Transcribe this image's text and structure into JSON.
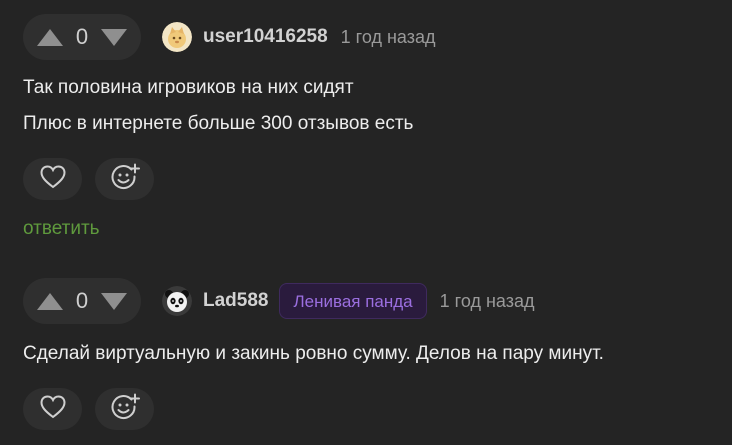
{
  "comments": [
    {
      "vote_count": "0",
      "username": "user10416258",
      "badge": "",
      "time": "1 год назад",
      "lines": [
        "Так половина игровиков на них сидят",
        "Плюс в интернете больше 300 отзывов есть"
      ],
      "reply_label": "ответить",
      "avatar_icon": "cat-avatar",
      "actions": [
        "heart-icon",
        "add-reaction-icon"
      ]
    },
    {
      "vote_count": "0",
      "username": "Lad588",
      "badge": "Ленивая панда",
      "time": "1 год назад",
      "lines": [
        "Сделай виртуальную и закинь ровно сумму. Делов на пару минут."
      ],
      "avatar_icon": "panda-avatar",
      "actions": [
        "heart-icon",
        "add-reaction-icon"
      ]
    }
  ],
  "colors": {
    "background": "#242424",
    "pill": "#2f2f2f",
    "reply": "#5f9a3d",
    "badge_text": "#9b6fe0",
    "badge_bg": "#2a1b3d"
  }
}
